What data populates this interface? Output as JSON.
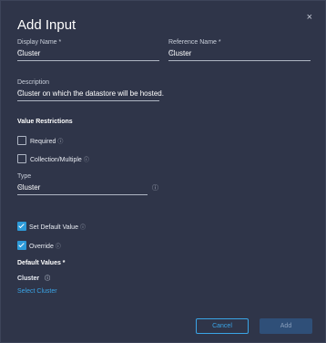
{
  "dialog": {
    "title": "Add Input",
    "close_glyph": "×",
    "info_glyph": "ⓘ"
  },
  "display_name": {
    "label": "Display Name *",
    "value": "Cluster"
  },
  "reference_name": {
    "label": "Reference Name *",
    "value": "Cluster"
  },
  "description": {
    "label": "Description",
    "value": "Cluster on which the datastore will be hosted."
  },
  "value_restrictions": {
    "heading": "Value Restrictions",
    "required": {
      "label": "Required",
      "checked": false
    },
    "collection": {
      "label": "Collection/Multiple",
      "checked": false
    }
  },
  "type": {
    "label": "Type",
    "value": "Cluster",
    "chevron": "⌄"
  },
  "set_default": {
    "label": "Set Default Value",
    "checked": true
  },
  "override": {
    "label": "Override",
    "checked": true
  },
  "default_values": {
    "heading": "Default Values *",
    "item_label": "Cluster",
    "select_link": "Select Cluster"
  },
  "footer": {
    "cancel_label": "Cancel",
    "add_label": "Add"
  },
  "colors": {
    "accent": "#3aa4e6",
    "checkbox_on": "#2d9ad8",
    "background": "#2f3549"
  },
  "icons": [
    "close-icon",
    "info-icon",
    "chevron-down-icon",
    "checkbox-checked-icon"
  ]
}
